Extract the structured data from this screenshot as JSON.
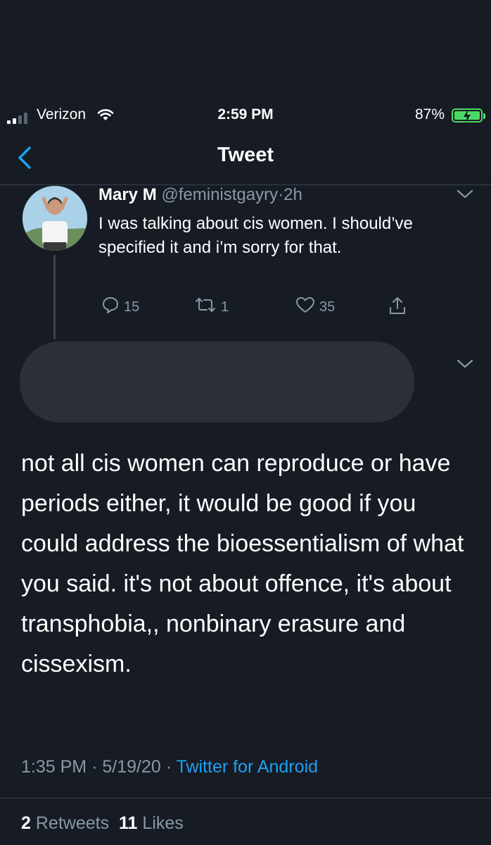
{
  "status_bar": {
    "carrier": "Verizon",
    "time": "2:59 PM",
    "battery_percent": "87%"
  },
  "nav": {
    "title": "Tweet"
  },
  "quoted_tweet": {
    "name": "Mary M",
    "handle": "@feministgayry",
    "separator": "·",
    "age": "2h",
    "text": "I was talking about cis women. I should’ve specified it and i’m sorry for that.",
    "replies": "15",
    "retweets": "1",
    "likes": "35"
  },
  "main_tweet": {
    "text": "not all cis women can reproduce or have periods either, it would be good if you could address the bioessentialism of what you said. it's not about offence, it's about transphobia,, nonbinary erasure and cissexism.",
    "time": "1:35 PM",
    "date": "5/19/20",
    "separator": "·",
    "source": "Twitter for Android",
    "retweet_count": "2",
    "retweet_label": "Retweets",
    "like_count": "11",
    "like_label": "Likes"
  },
  "colors": {
    "background": "#161b24",
    "secondary_text": "#8899a6",
    "accent": "#1da1f2",
    "battery": "#4cd964"
  },
  "icons": [
    "signal-icon",
    "wifi-icon",
    "battery-icon",
    "back-chevron-icon",
    "chevron-down-icon",
    "reply-icon",
    "retweet-icon",
    "like-icon",
    "share-icon"
  ]
}
